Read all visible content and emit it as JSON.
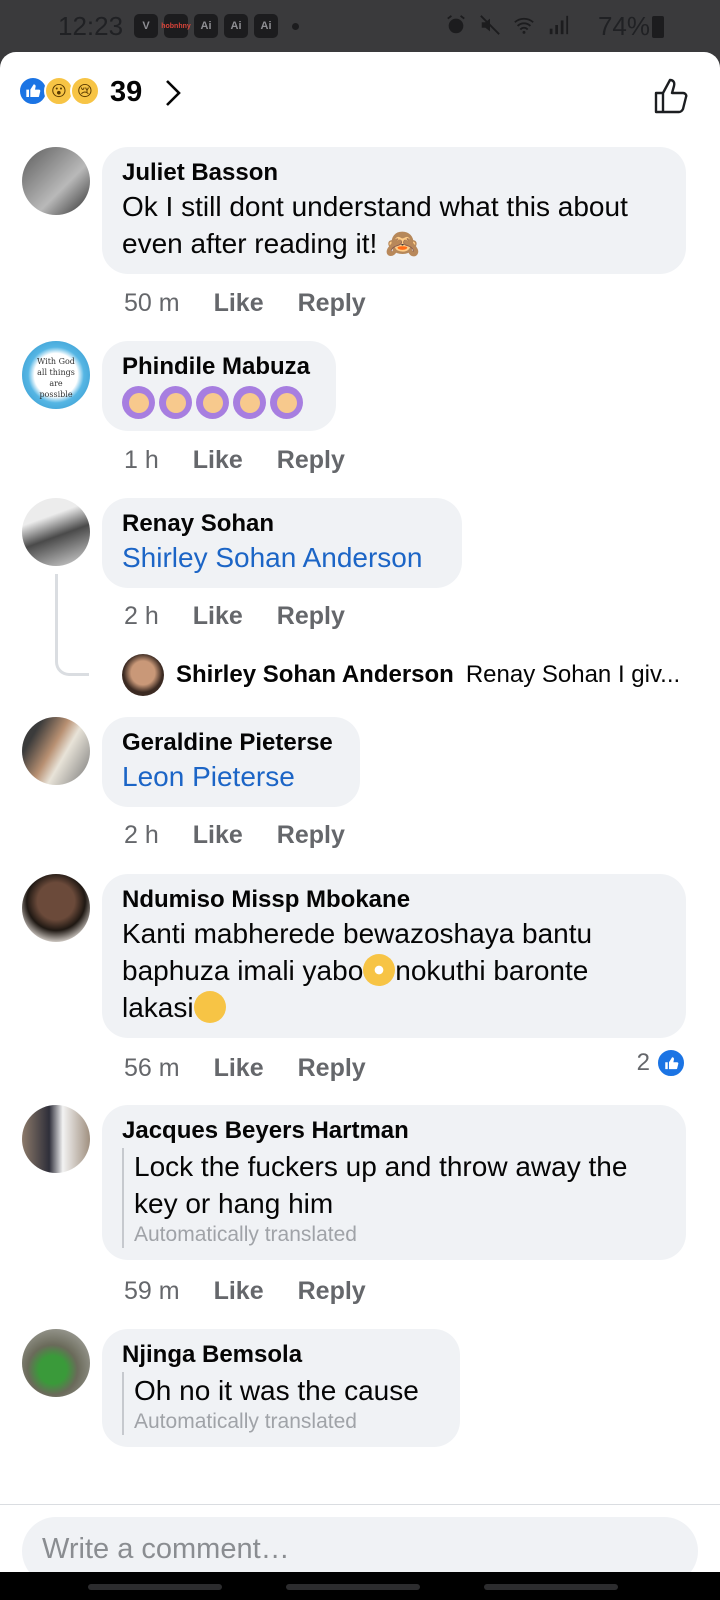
{
  "status_bar": {
    "time": "12:23",
    "app_icons": [
      "V",
      "hobnhny",
      "Ai",
      "Ai",
      "Ai"
    ],
    "battery": "74%"
  },
  "reactions": {
    "count": "39",
    "types": [
      "like",
      "wow",
      "sad"
    ]
  },
  "comments": [
    {
      "author": "Juliet Basson",
      "text": "Ok I still dont understand what this about even after reading it! 🙈",
      "time": "50 m",
      "like": "Like",
      "reply": "Reply"
    },
    {
      "author": "Phindile Mabuza",
      "emoji": [
        "🙆",
        "🙆",
        "🙆",
        "🙆",
        "🙆"
      ],
      "avatar_text": "With God all things are possible",
      "time": "1 h",
      "like": "Like",
      "reply": "Reply"
    },
    {
      "author": "Renay Sohan",
      "mention": "Shirley Sohan Anderson",
      "time": "2 h",
      "like": "Like",
      "reply": "Reply",
      "reply_preview": {
        "author": "Shirley Sohan Anderson",
        "text": "Renay Sohan I giv..."
      }
    },
    {
      "author": "Geraldine Pieterse",
      "mention": "Leon Pieterse",
      "time": "2 h",
      "like": "Like",
      "reply": "Reply"
    },
    {
      "author": "Ndumiso Missp Mbokane",
      "text_part1": "Kanti mabherede bewazoshaya bantu baphuza imali yabo",
      "text_part2": "nokuthi baronte lakasi",
      "time": "56 m",
      "like": "Like",
      "reply": "Reply",
      "likes": "2"
    },
    {
      "author": "Jacques Beyers Hartman",
      "text": "Lock the fuckers up and throw away the key or hang him",
      "note": "Automatically translated",
      "time": "59 m",
      "like": "Like",
      "reply": "Reply"
    },
    {
      "author": "Njinga Bemsola",
      "text": "Oh no it was the cause",
      "note": "Automatically translated"
    }
  ],
  "composer": {
    "placeholder": "Write a comment…"
  },
  "colors": {
    "accent": "#1b74e4",
    "mention": "#1c65c6",
    "bubble": "#f0f2f5",
    "meta": "#65676b"
  }
}
